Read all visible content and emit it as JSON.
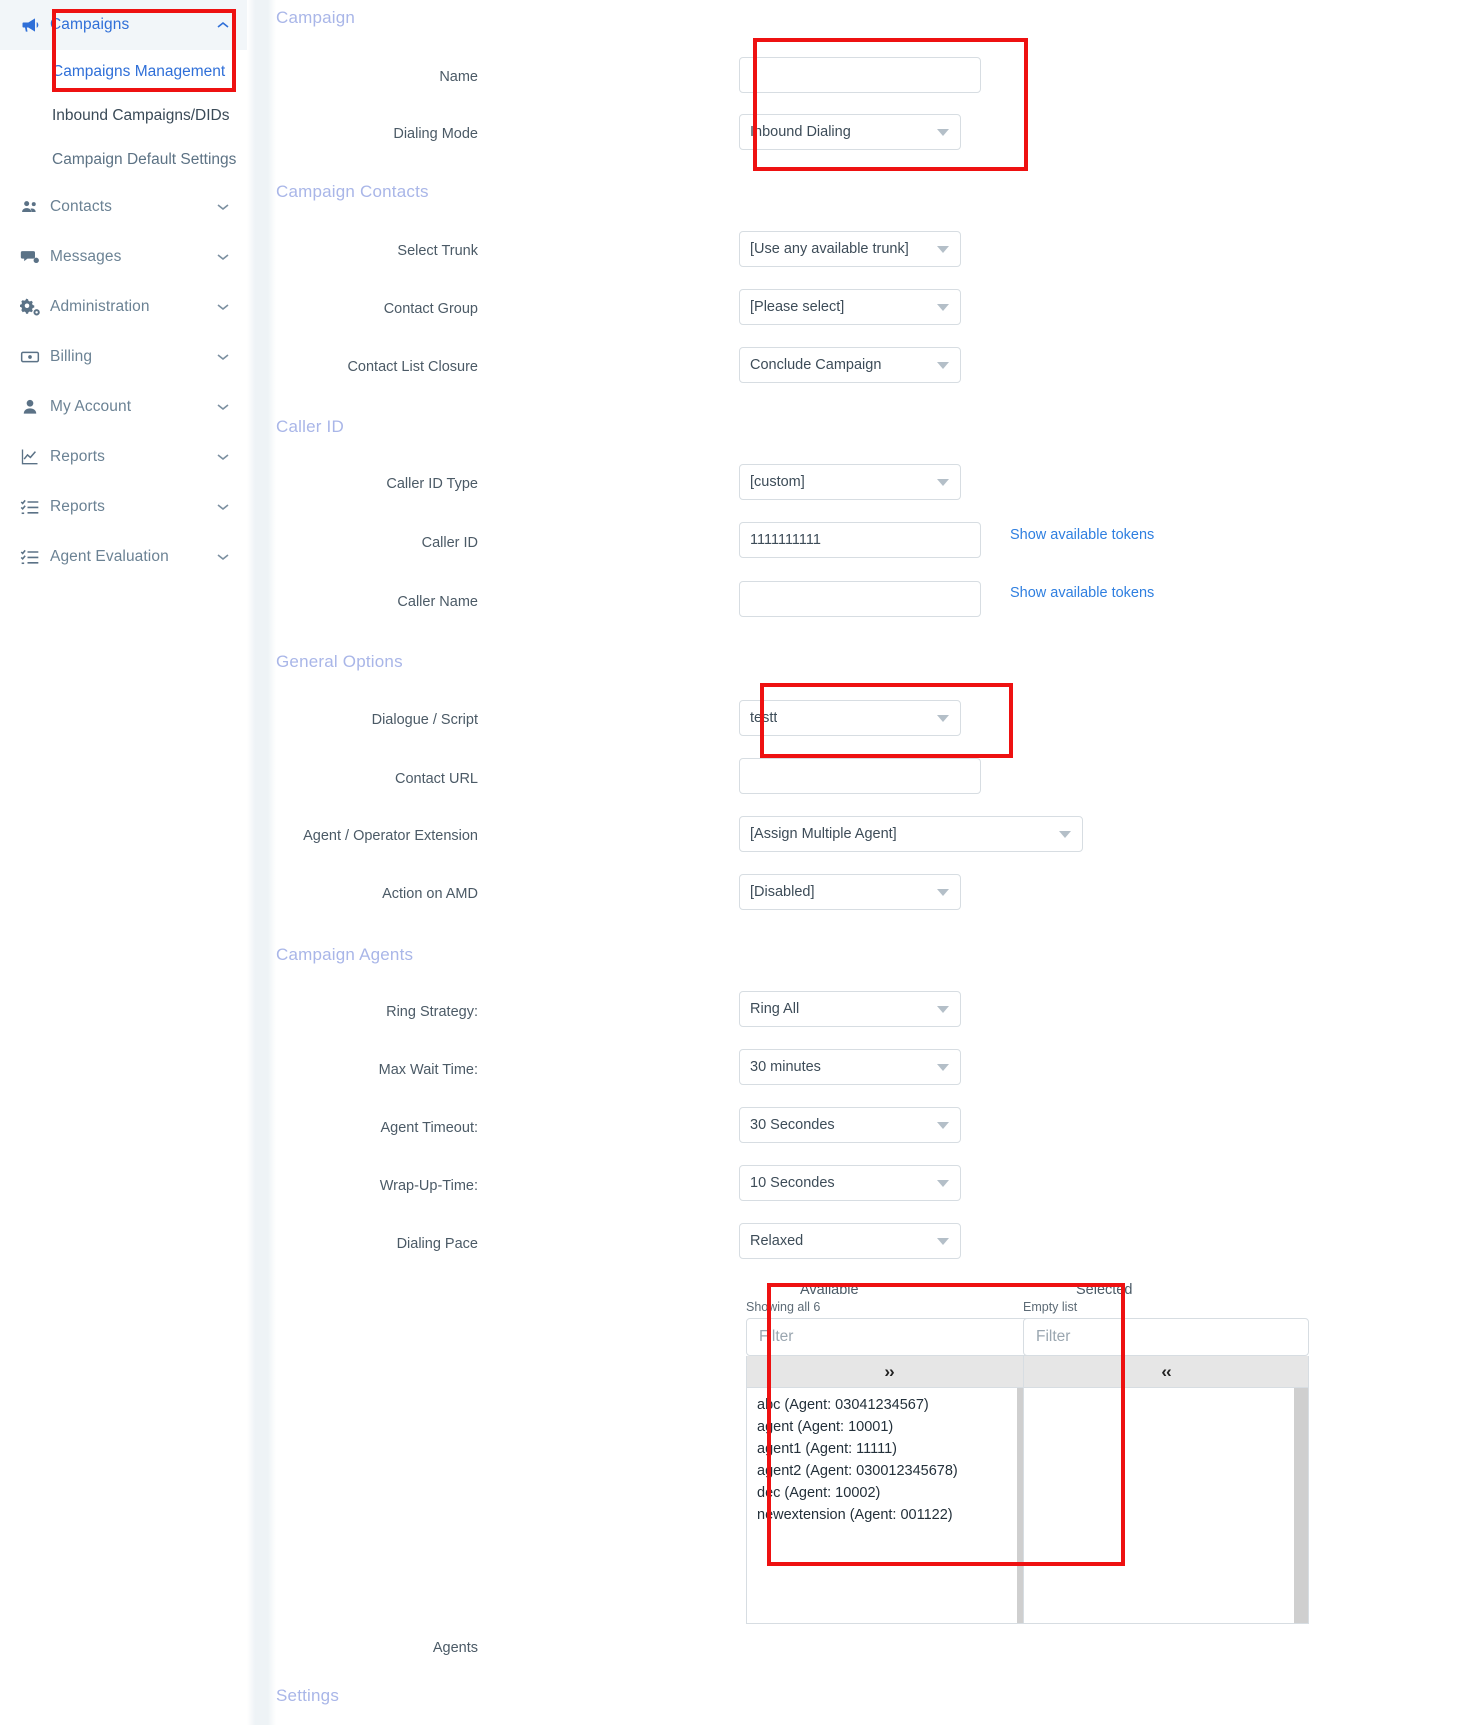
{
  "sidebar": {
    "items": [
      {
        "label": "Campaigns",
        "icon": "megaphone-icon",
        "caret": "chevron-up-icon",
        "state": "expanded-active"
      },
      {
        "label": "Contacts",
        "icon": "people-icon",
        "caret": "chevron-down-icon",
        "state": "collapsed"
      },
      {
        "label": "Messages",
        "icon": "chat-icon",
        "caret": "chevron-down-icon",
        "state": "collapsed"
      },
      {
        "label": "Administration",
        "icon": "gears-icon",
        "caret": "chevron-down-icon",
        "state": "collapsed"
      },
      {
        "label": "Billing",
        "icon": "money-icon",
        "caret": "chevron-down-icon",
        "state": "collapsed"
      },
      {
        "label": "My Account",
        "icon": "user-icon",
        "caret": "chevron-down-icon",
        "state": "collapsed"
      },
      {
        "label": "Reports",
        "icon": "chart-line-icon",
        "caret": "chevron-down-icon",
        "state": "collapsed"
      },
      {
        "label": "Reports",
        "icon": "checklist-icon",
        "caret": "chevron-down-icon",
        "state": "collapsed"
      },
      {
        "label": "Agent Evaluation",
        "icon": "checklist-icon",
        "caret": "chevron-down-icon",
        "state": "collapsed"
      }
    ],
    "campaign_subitems": [
      {
        "label": "Campaigns Management",
        "state": "selected"
      },
      {
        "label": "Inbound Campaigns/DIDs",
        "state": "normal"
      },
      {
        "label": "Campaign Default Settings",
        "state": "muted"
      }
    ]
  },
  "form": {
    "sections": {
      "campaign": "Campaign",
      "campaign_contacts": "Campaign Contacts",
      "caller_id": "Caller ID",
      "general_options": "General Options",
      "campaign_agents": "Campaign Agents",
      "settings": "Settings"
    },
    "fields": {
      "name": {
        "label": "Name",
        "value": "",
        "type": "text"
      },
      "dialing_mode": {
        "label": "Dialing Mode",
        "value": "Inbound Dialing",
        "type": "select"
      },
      "select_trunk": {
        "label": "Select Trunk",
        "value": "[Use any available trunk]",
        "type": "select"
      },
      "contact_group": {
        "label": "Contact Group",
        "value": "[Please select]",
        "type": "select"
      },
      "contact_list_closure": {
        "label": "Contact List Closure",
        "value": "Conclude Campaign",
        "type": "select"
      },
      "caller_id_type": {
        "label": "Caller ID Type",
        "value": "[custom]",
        "type": "select"
      },
      "caller_id": {
        "label": "Caller ID",
        "value": "1111111111",
        "type": "text",
        "link": "Show available tokens"
      },
      "caller_name": {
        "label": "Caller Name",
        "value": "",
        "type": "text",
        "link": "Show available tokens"
      },
      "dialogue_script": {
        "label": "Dialogue / Script",
        "value": "testt",
        "type": "select"
      },
      "contact_url": {
        "label": "Contact URL",
        "value": "",
        "type": "text"
      },
      "agent_operator_extension": {
        "label": "Agent / Operator Extension",
        "value": "[Assign Multiple Agent]",
        "type": "select"
      },
      "action_on_amd": {
        "label": "Action on AMD",
        "value": "[Disabled]",
        "type": "select"
      },
      "ring_strategy": {
        "label": "Ring Strategy:",
        "value": "Ring All",
        "type": "select"
      },
      "max_wait_time": {
        "label": "Max Wait Time:",
        "value": "30 minutes",
        "type": "select"
      },
      "agent_timeout": {
        "label": "Agent Timeout:",
        "value": "30 Secondes",
        "type": "select"
      },
      "wrap_up_time": {
        "label": "Wrap-Up-Time:",
        "value": "10 Secondes",
        "type": "select"
      },
      "dialing_pace": {
        "label": "Dialing Pace",
        "value": "Relaxed",
        "type": "select"
      },
      "agents": {
        "label": "Agents"
      }
    }
  },
  "dual_list": {
    "available": {
      "title": "Available",
      "count_text": "Showing all 6",
      "filter_placeholder": "Filter",
      "move_button": "››",
      "items": [
        "abc (Agent: 03041234567)",
        "agent (Agent: 10001)",
        "agent1 (Agent: 11111)",
        "agent2 (Agent: 030012345678)",
        "dec (Agent: 10002)",
        "newextension (Agent: 001122)"
      ]
    },
    "selected": {
      "title": "Selected",
      "count_text": "Empty list",
      "filter_placeholder": "Filter",
      "move_button": "‹‹",
      "items": []
    }
  },
  "colors": {
    "accent_blue": "#2f6fd8",
    "link_blue": "#2f7fe0",
    "section_heading": "#a9b6e8",
    "annotation_red": "#ee1111",
    "sidebar_active_bg": "#f2f6f9"
  }
}
